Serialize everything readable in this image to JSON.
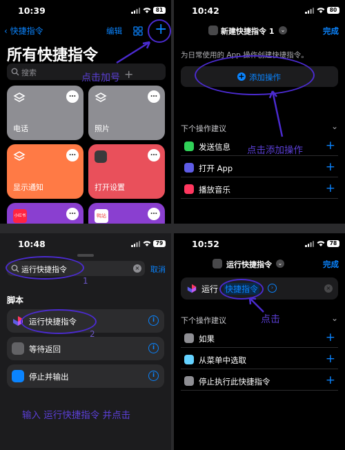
{
  "panel1": {
    "time": "10:39",
    "battery": "81",
    "back_label": "快捷指令",
    "edit_label": "编辑",
    "title": "所有快捷指令",
    "search_placeholder": "搜索",
    "cards": [
      {
        "label": "电话",
        "color": "#8e8e93"
      },
      {
        "label": "照片",
        "color": "#8e8e93"
      },
      {
        "label": "显示通知",
        "color": "#ff7a45"
      },
      {
        "label": "打开设置",
        "color": "#e9505b"
      },
      {
        "label": "",
        "color": "#8a3fd0",
        "badge": "小红书"
      },
      {
        "label": "",
        "color": "#8a3fd0",
        "badge": "鸭站"
      }
    ],
    "annotation": "点击加号"
  },
  "panel2": {
    "time": "10:42",
    "battery": "80",
    "title": "新建快捷指令 1",
    "done": "完成",
    "desc": "为日常使用的 App 操作创建快捷指令。",
    "add_action": "添加操作",
    "suggest_header": "下个操作建议",
    "suggestions": [
      {
        "label": "发送信息",
        "icon": "message-icon",
        "color": "#30d158"
      },
      {
        "label": "打开 App",
        "icon": "app-icon",
        "color": "#5e5ce6"
      },
      {
        "label": "播放音乐",
        "icon": "music-icon",
        "color": "#ff375f"
      }
    ],
    "annotation": "点击添加操作"
  },
  "panel3": {
    "time": "10:48",
    "battery": "79",
    "search_value": "运行快捷指令",
    "cancel": "取消",
    "section": "脚本",
    "items": [
      {
        "label": "运行快捷指令",
        "icon": "shortcuts-icon",
        "color": "#2c2c2e"
      },
      {
        "label": "等待返回",
        "icon": "wait-icon",
        "color": "#636366"
      },
      {
        "label": "停止并输出",
        "icon": "stop-output-icon",
        "color": "#0a84ff"
      }
    ],
    "mark1": "1",
    "mark2": "2",
    "annotation": "输入 运行快捷指令 并点击"
  },
  "panel4": {
    "time": "10:52",
    "battery": "78",
    "title": "运行快捷指令",
    "done": "完成",
    "action_verb": "运行",
    "action_param": "快捷指令",
    "suggest_header": "下个操作建议",
    "suggestions": [
      {
        "label": "如果",
        "icon": "if-icon",
        "color": "#8e8e93"
      },
      {
        "label": "从菜单中选取",
        "icon": "menu-icon",
        "color": "#64d2ff"
      },
      {
        "label": "停止执行此快捷指令",
        "icon": "stop-icon",
        "color": "#8e8e93"
      }
    ],
    "annotation": "点击"
  },
  "colors": {
    "accent": "#0a84ff",
    "annotation": "#5b3fd6"
  }
}
